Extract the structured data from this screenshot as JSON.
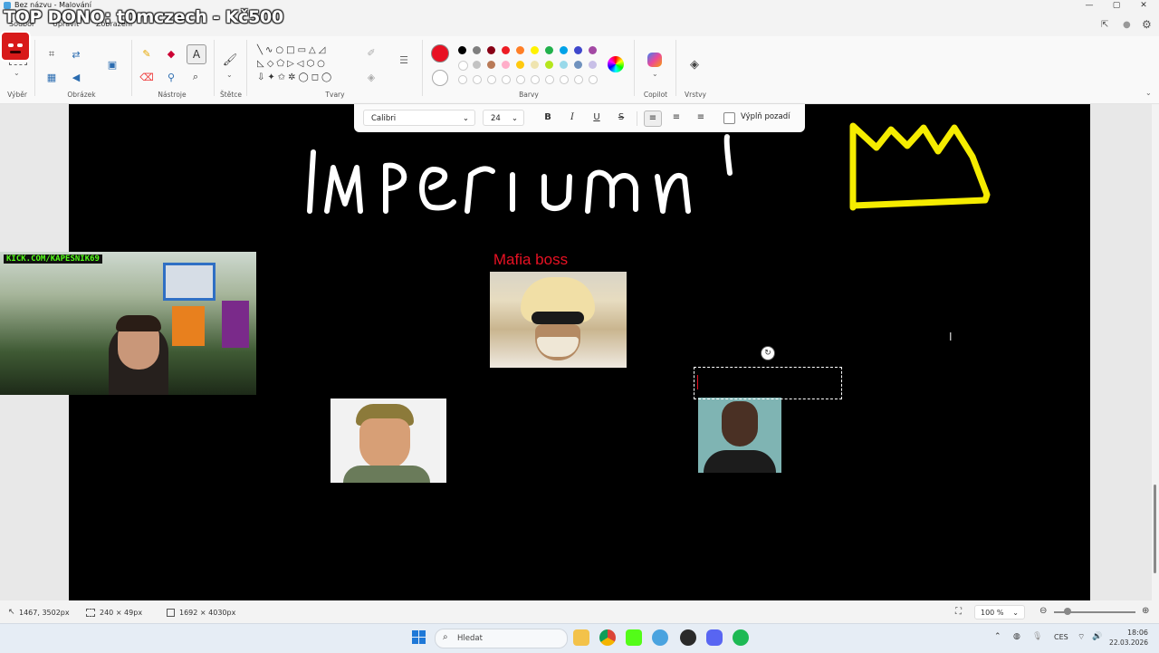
{
  "window": {
    "title": "Bez názvu - Malování",
    "controls": [
      "—",
      "▢",
      "✕"
    ]
  },
  "menu": {
    "items": [
      "Soubor",
      "Upravit",
      "Zobrazení"
    ]
  },
  "ribbon": {
    "groups": {
      "selection": "Výběr",
      "image": "Obrázek",
      "tools": "Nástroje",
      "brushes": "Štětce",
      "shapes": "Tvary",
      "colors": "Barvy",
      "copilot": "Copilot",
      "layers": "Vrstvy"
    },
    "active_color": "#e81123",
    "palette": [
      "#000000",
      "#7f7f7f",
      "#880015",
      "#ed1c24",
      "#ff7f27",
      "#fff200",
      "#22b14c",
      "#00a2e8",
      "#3f48cc",
      "#a349a4"
    ],
    "palette2": [
      "#ffffff",
      "#c3c3c3",
      "#b97a57",
      "#ffaec9",
      "#ffc90e",
      "#efe4b0",
      "#b5e61d",
      "#99d9ea",
      "#7092be",
      "#c8bfe7"
    ]
  },
  "text_toolbar": {
    "font": "Calibri",
    "size": "24",
    "fill_label": "Výplň pozadí"
  },
  "canvas": {
    "heading": "Imperium",
    "caption": "Mafia boss"
  },
  "status": {
    "cursor": "1467, 3502px",
    "selection": "240 × 49px",
    "canvas_size": "1692 × 4030px",
    "zoom": "100 %"
  },
  "taskbar": {
    "search_placeholder": "Hledat",
    "language": "CES",
    "time": "18:06",
    "date": "22.03.2026"
  },
  "overlay": {
    "donation": "TOP DONO: t0mczech - Kč500",
    "webcam_banner": "KICK.COM/KAPESNIK69"
  }
}
